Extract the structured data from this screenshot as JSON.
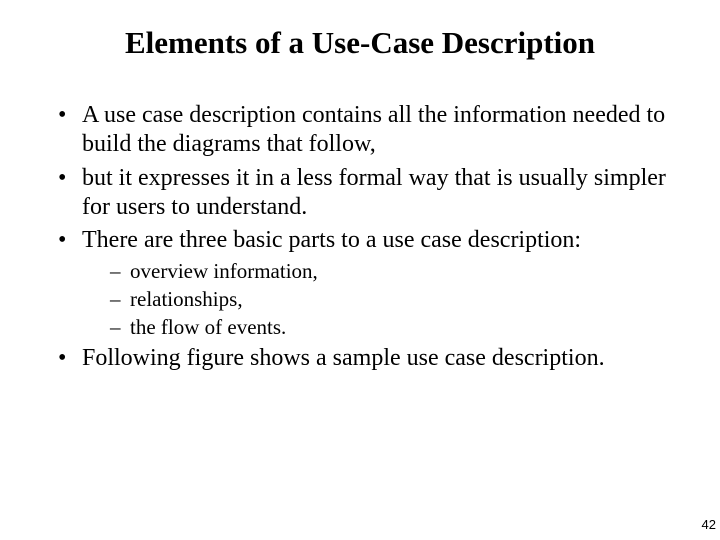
{
  "title": "Elements of a Use-Case Description",
  "bullets": {
    "b1": "A use case description contains all the information needed to build the diagrams that follow,",
    "b2": "but it expresses it in a less formal way that is usually simpler for users to understand.",
    "b3": "There are three basic parts to a use case description:",
    "b3_sub": {
      "s1": "overview information,",
      "s2": "relationships,",
      "s3": "the flow of events."
    },
    "b4": "Following figure shows a sample use case description."
  },
  "page_number": "42"
}
